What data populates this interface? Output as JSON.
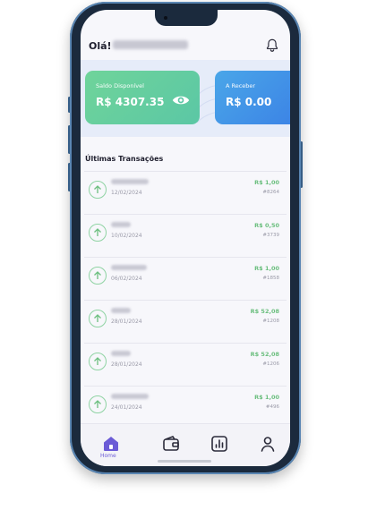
{
  "header": {
    "greeting": "Olá!",
    "user_name_blurred": "CARLOS EDUARDO",
    "bell_icon": "bell-icon"
  },
  "cards": [
    {
      "label": "Saldo Disponível",
      "value": "R$ 4307.35",
      "icon": "eye-icon",
      "color": "#5bc7a5"
    },
    {
      "label": "A Receber",
      "value": "R$ 0.00",
      "color": "#3b82e6"
    }
  ],
  "transactions_title": "Últimas Transações",
  "transactions": [
    {
      "date": "12/02/2024",
      "amount": "R$ 1,00",
      "code": "#8264"
    },
    {
      "date": "10/02/2024",
      "amount": "R$ 0,50",
      "code": "#3739"
    },
    {
      "date": "06/02/2024",
      "amount": "R$ 1,00",
      "code": "#1858"
    },
    {
      "date": "28/01/2024",
      "amount": "R$ 52,08",
      "code": "#1208"
    },
    {
      "date": "28/01/2024",
      "amount": "R$ 52,08",
      "code": "#1206"
    },
    {
      "date": "24/01/2024",
      "amount": "R$ 1,00",
      "code": "#496"
    }
  ],
  "tabbar": {
    "home_label": "Home",
    "items": [
      "home-icon",
      "wallet-icon",
      "chart-icon",
      "user-icon"
    ],
    "active_color": "#6b5bd6"
  }
}
